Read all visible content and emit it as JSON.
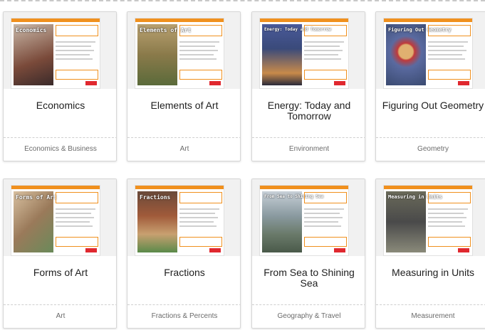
{
  "cards": [
    {
      "title": "Economics",
      "thumb_title": "Economics",
      "category": "Economics & Business",
      "photo_color": "#7a4a3a"
    },
    {
      "title": "Elements of Art",
      "thumb_title": "Elements of Art",
      "category": "Art",
      "photo_color": "#8a7a4a"
    },
    {
      "title": "Energy: Today and Tomorrow",
      "thumb_title": "Energy: Today and Tomorrow",
      "category": "Environment",
      "photo_color": "#3a4a7a"
    },
    {
      "title": "Figuring Out Geometry",
      "thumb_title": "Figuring Out Geometry",
      "category": "Geometry",
      "photo_color": "#5a6aa0"
    },
    {
      "title": "Forms of Art",
      "thumb_title": "Forms of Art",
      "category": "Art",
      "photo_color": "#9a7a5a"
    },
    {
      "title": "Fractions",
      "thumb_title": "Fractions",
      "category": "Fractions & Percents",
      "photo_color": "#a05a3a"
    },
    {
      "title": "From Sea to Shining Sea",
      "thumb_title": "From Sea to Shining Sea",
      "category": "Geography & Travel",
      "photo_color": "#6a7a6a"
    },
    {
      "title": "Measuring in Units",
      "thumb_title": "Measuring in Units",
      "category": "Measurement",
      "photo_color": "#4a4a4a"
    }
  ],
  "colors": {
    "accent": "#f0901e",
    "logo": "#e0282f"
  }
}
